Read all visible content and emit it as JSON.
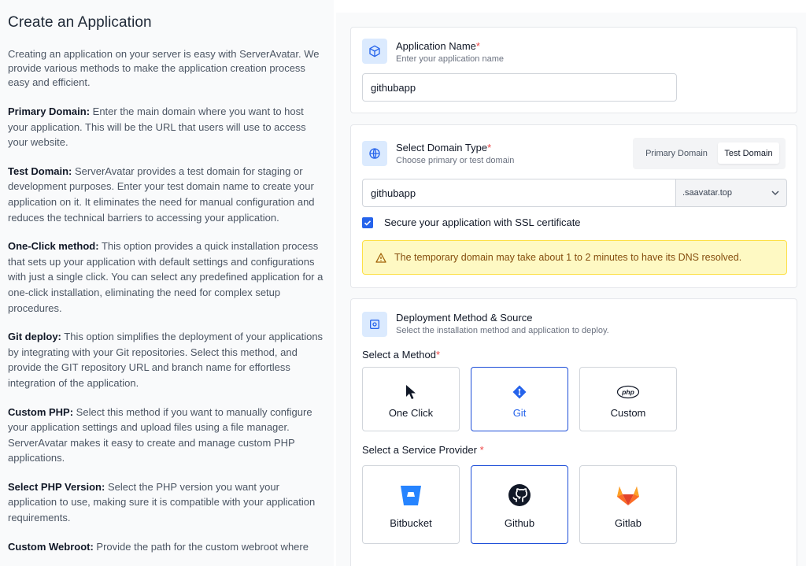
{
  "help": {
    "title": "Create an Application",
    "intro": "Creating an application on your server is easy with ServerAvatar. We provide various methods to make the application creation process easy and efficient.",
    "sections": [
      {
        "term": "Primary Domain:",
        "text": " Enter the main domain where you want to host your application. This will be the URL that users will use to access your website."
      },
      {
        "term": "Test Domain:",
        "text": " ServerAvatar provides a test domain for staging or development purposes. Enter your test domain name to create your application on it. It eliminates the need for manual configuration and reduces the technical barriers to accessing your application."
      },
      {
        "term": "One-Click method:",
        "text": " This option provides a quick installation process that sets up your application with default settings and configurations with just a single click. You can select any predefined application for a one-click installation, eliminating the need for complex setup procedures."
      },
      {
        "term": "Git deploy:",
        "text": " This option simplifies the deployment of your applications by integrating with your Git repositories. Select this method, and provide the GIT repository URL and branch name for effortless integration of the application."
      },
      {
        "term": "Custom PHP:",
        "text": " Select this method if you want to manually configure your application settings and upload files using a file manager. ServerAvatar makes it easy to create and manage custom PHP applications."
      },
      {
        "term": "Select PHP Version:",
        "text": " Select the PHP version you want your application to use, making sure it is compatible with your application requirements."
      },
      {
        "term": "Custom Webroot:",
        "text": " Provide the path for the custom webroot where"
      }
    ]
  },
  "app_name": {
    "title": "Application Name",
    "required_mark": "*",
    "subtitle": "Enter your application name",
    "value": "githubapp",
    "icon": "cube-icon"
  },
  "domain": {
    "title": "Select Domain Type",
    "required_mark": "*",
    "subtitle": "Choose primary or test domain",
    "icon": "globe-icon",
    "types": [
      "Primary Domain",
      "Test Domain"
    ],
    "selected_type": "Test Domain",
    "value": "githubapp",
    "suffix": ".saavatar.top",
    "ssl_label": "Secure your application with SSL certificate",
    "ssl_checked": true,
    "notice": "The temporary domain may take about 1 to 2 minutes to have its DNS resolved."
  },
  "deployment": {
    "title": "Deployment Method & Source",
    "subtitle": "Select the installation method and application to deploy.",
    "icon": "deploy-icon",
    "method_label": "Select a Method",
    "method_required": "*",
    "methods": [
      {
        "label": "One Click",
        "icon": "cursor-icon"
      },
      {
        "label": "Git",
        "icon": "git-icon"
      },
      {
        "label": "Custom",
        "icon": "php-icon"
      }
    ],
    "selected_method": "Git",
    "provider_label": "Select a Service Provider",
    "provider_required": "*",
    "providers": [
      {
        "label": "Bitbucket",
        "icon": "bitbucket-icon"
      },
      {
        "label": "Github",
        "icon": "github-icon"
      },
      {
        "label": "Gitlab",
        "icon": "gitlab-icon"
      }
    ],
    "selected_provider": "Github"
  },
  "colors": {
    "accent": "#2563eb",
    "required": "#ef4444",
    "warning_bg": "#fef9c3",
    "warning_text": "#854d0e"
  }
}
